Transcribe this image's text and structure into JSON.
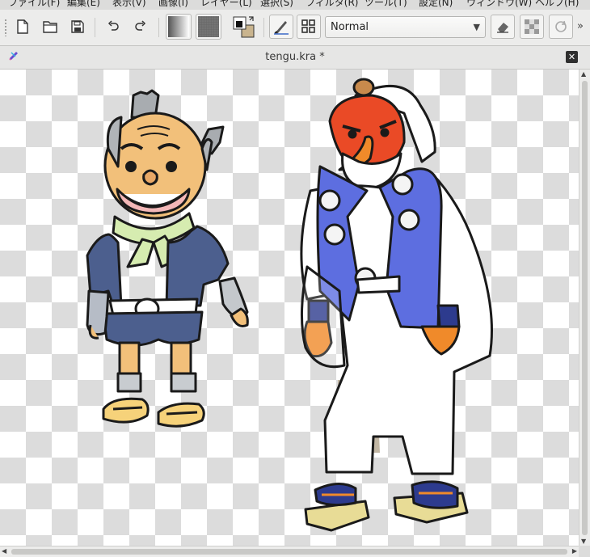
{
  "menubar": {
    "items": [
      {
        "label": "ファイル(F)"
      },
      {
        "label": "編集(E)"
      },
      {
        "label": "表示(V)"
      },
      {
        "label": "画像(I)"
      },
      {
        "label": "レイヤー(L)"
      },
      {
        "label": "選択(S)"
      },
      {
        "label": "フィルタ(R)"
      },
      {
        "label": "ツール(T)"
      },
      {
        "label": "設定(N)"
      },
      {
        "label": "ウィンドウ(W)"
      },
      {
        "label": "ヘルプ(H)"
      }
    ]
  },
  "toolbar": {
    "icons": {
      "new": "new-document-icon",
      "open": "open-folder-icon",
      "save": "save-icon",
      "undo": "undo-icon",
      "redo": "redo-icon",
      "gradient": "gradient-icon",
      "pattern": "pattern-icon",
      "colors": "fg-bg-color-icon",
      "brush": "brush-preset-icon",
      "workspace": "workspace-icon",
      "eraser": "eraser-icon",
      "alpha": "preserve-alpha-icon",
      "reload": "reload-preset-icon",
      "overflow": "toolbar-overflow-icon"
    },
    "blend_mode": "Normal",
    "overflow_glyph": "»"
  },
  "document": {
    "title": "tengu.kra *",
    "close_glyph": "✕"
  },
  "colors": {
    "fg": "#111111",
    "bg": "#c9b48e",
    "accent": "#3b68c8"
  }
}
